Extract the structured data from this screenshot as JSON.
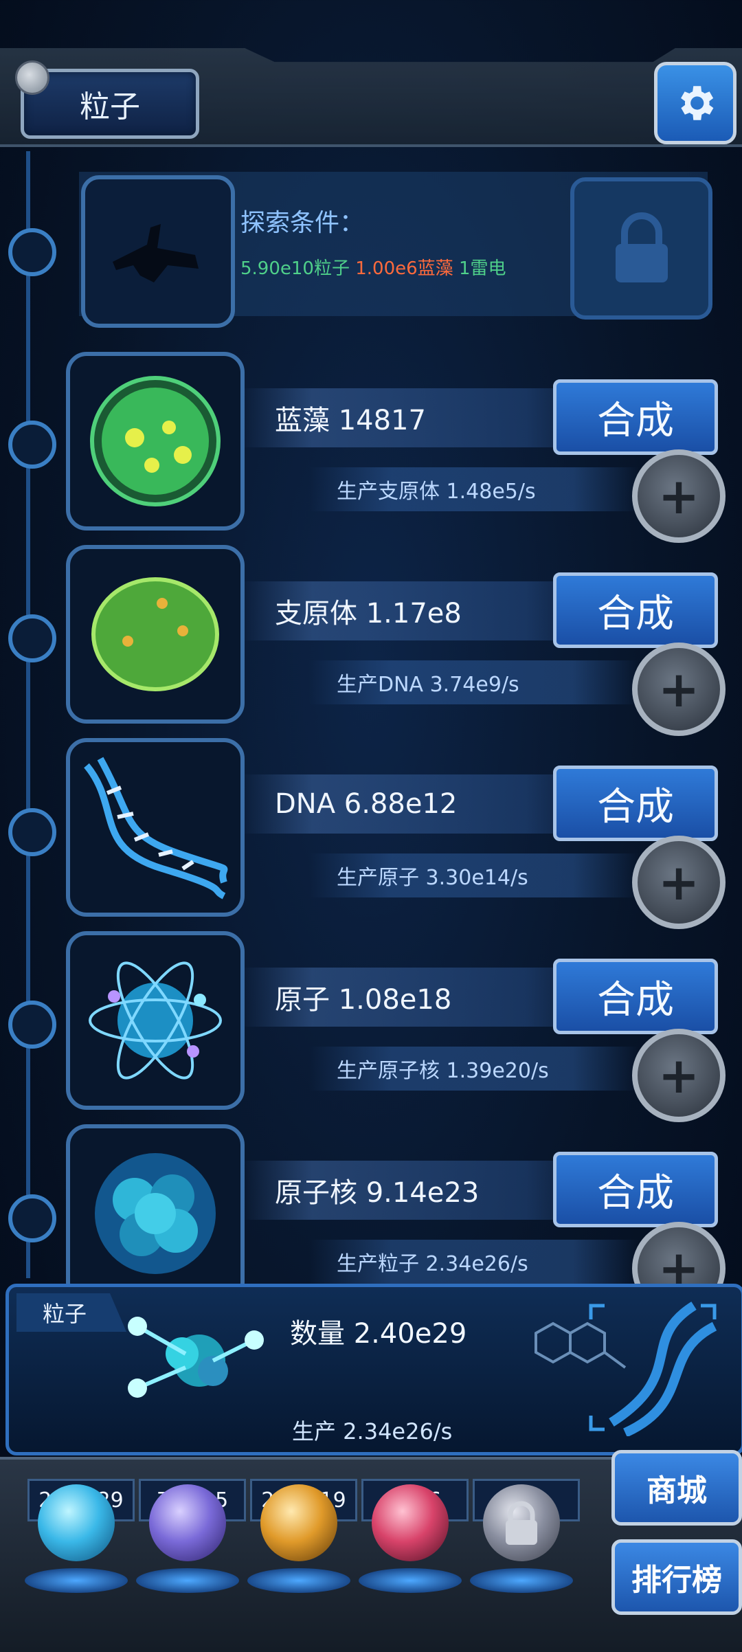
{
  "header": {
    "title": "粒子"
  },
  "locked": {
    "title": "探索条件：",
    "requirements": [
      {
        "text": "5.90e10粒子",
        "color": "#4fd08a"
      },
      {
        "text": "1.00e6蓝藻",
        "color": "#ff6a3c"
      },
      {
        "text": "1雷电",
        "color": "#4fd08a"
      }
    ]
  },
  "items": [
    {
      "name": "蓝藻 14817",
      "synth_label": "合成",
      "production": "生产支原体 1.48e5/s",
      "icon": "cyanobacteria-icon"
    },
    {
      "name": "支原体 1.17e8",
      "synth_label": "合成",
      "production": "生产DNA 3.74e9/s",
      "icon": "mycoplasma-icon"
    },
    {
      "name": "DNA 6.88e12",
      "synth_label": "合成",
      "production": "生产原子 3.30e14/s",
      "icon": "dna-icon"
    },
    {
      "name": "原子 1.08e18",
      "synth_label": "合成",
      "production": "生产原子核 1.39e20/s",
      "icon": "atom-icon"
    },
    {
      "name": "原子核 9.14e23",
      "synth_label": "合成",
      "production": "生产粒子 2.34e26/s",
      "icon": "nucleus-icon"
    }
  ],
  "panel": {
    "tag": "粒子",
    "count": "数量 2.40e29",
    "production": "生产 2.34e26/s"
  },
  "resources": [
    {
      "value": "2.40e29",
      "icon": "particle-orb-icon",
      "color": "#3ab8e8"
    },
    {
      "value": "7.47e5",
      "icon": "lightning-orb-icon",
      "color": "#7a6ad8"
    },
    {
      "value": "2.21e19",
      "icon": "fire-orb-icon",
      "color": "#e09a2a"
    },
    {
      "value": "4076",
      "icon": "brain-orb-icon",
      "color": "#d8436a"
    },
    {
      "value": "",
      "icon": "locked-orb-icon",
      "color": "#8a8fa0"
    }
  ],
  "side_buttons": {
    "shop": "商城",
    "ranking": "排行榜"
  }
}
